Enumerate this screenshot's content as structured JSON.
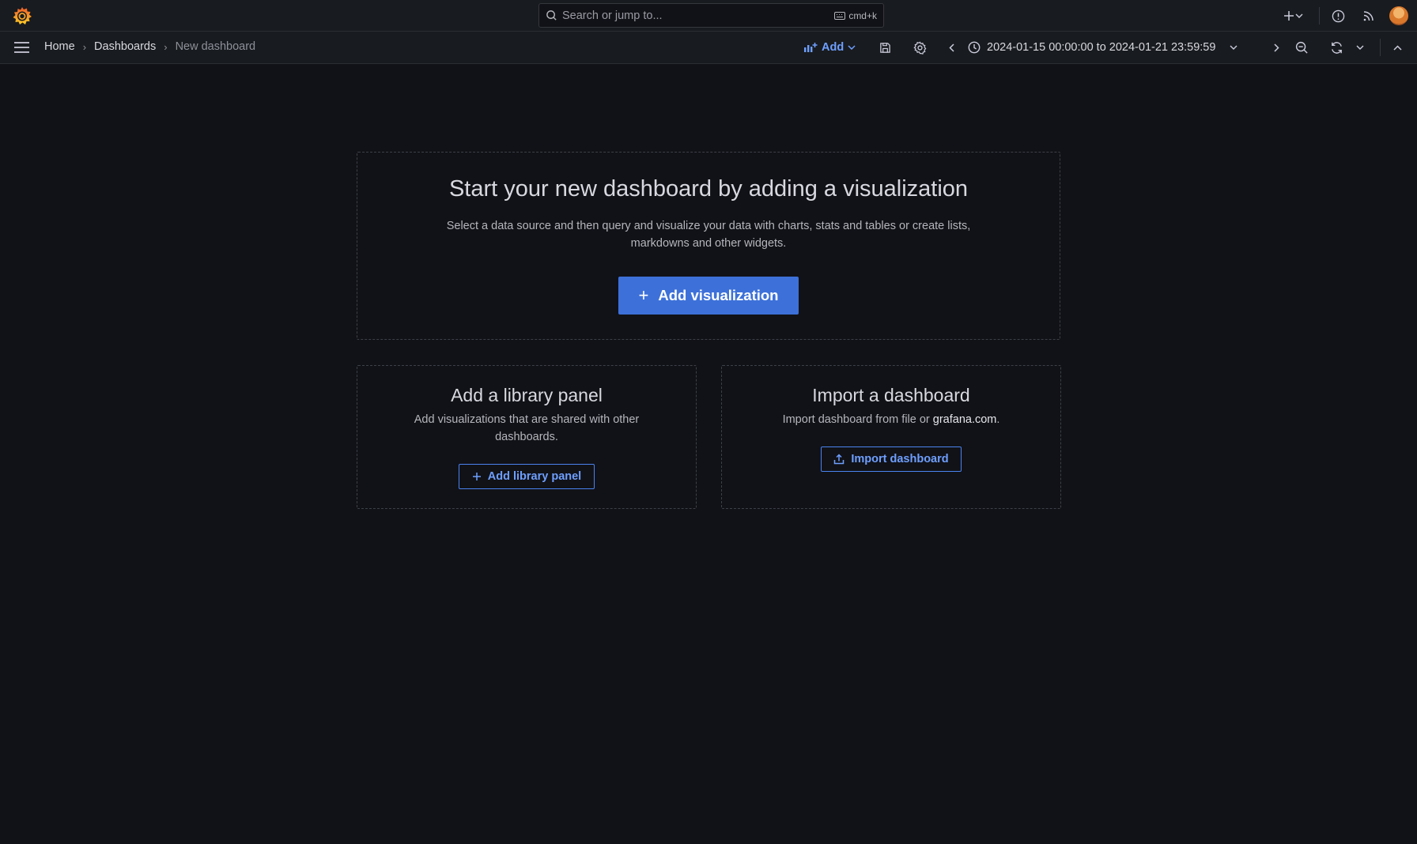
{
  "colors": {
    "accent": "#3d71d9",
    "link": "#6e9fff",
    "background": "#111217",
    "bar": "#181b1f"
  },
  "topbar": {
    "logo_icon": "grafana-logo-icon",
    "search": {
      "placeholder": "Search or jump to...",
      "shortcut": "cmd+k"
    },
    "icons": [
      "plus-icon",
      "chevron-down-icon",
      "help-icon",
      "rss-news-icon",
      "avatar"
    ]
  },
  "subbar": {
    "breadcrumbs": [
      "Home",
      "Dashboards",
      "New dashboard"
    ],
    "add_label": "Add",
    "time_range": "2024-01-15 00:00:00 to 2024-01-21 23:59:59",
    "icons": [
      "save-icon",
      "gear-icon",
      "chevron-left-icon",
      "clock-icon",
      "chevron-right-icon",
      "zoom-out-icon",
      "refresh-icon",
      "chevron-up-icon"
    ]
  },
  "main": {
    "title": "Start your new dashboard by adding a visualization",
    "description": "Select a data source and then query and visualize your data with charts, stats and tables or create lists, markdowns and other widgets.",
    "button": "Add visualization"
  },
  "library_panel": {
    "title": "Add a library panel",
    "description": "Add visualizations that are shared with other dashboards.",
    "button": "Add library panel"
  },
  "import_panel": {
    "title": "Import a dashboard",
    "description_prefix": "Import dashboard from file or ",
    "link": "grafana.com",
    "description_suffix": ".",
    "button": "Import dashboard"
  }
}
